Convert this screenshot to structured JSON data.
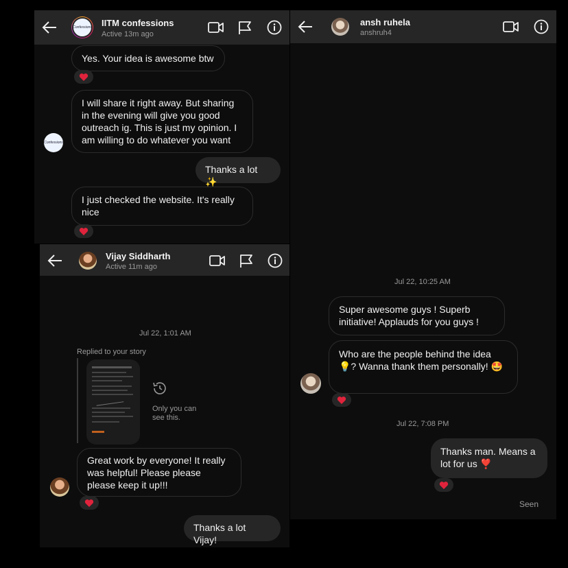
{
  "chat1": {
    "name": "IITM confessions",
    "status": "Active 13m ago",
    "avatar_text": "Confessions",
    "messages": [
      "Yes. Your idea is awesome btw",
      "I will share it right away. But sharing in the evening will give you good outreach ig. This is just my opinion. I am willing to do whatever you want",
      "Thanks a lot ✨",
      "I just checked the website. It's really nice"
    ]
  },
  "chat2": {
    "name": "Vijay Siddharth",
    "status": "Active 11m ago",
    "timestamp": "Jul 22, 1:01 AM",
    "story_reply_label": "Replied to your story",
    "story_note": "Only you can see this.",
    "messages": [
      "Great work by everyone! It really was helpful! Please please please keep it up!!!",
      "Thanks a lot Vijay!"
    ]
  },
  "chat3": {
    "name": "ansh ruhela",
    "username": "anshruh4",
    "timestamps": [
      "Jul 22, 10:25 AM",
      "Jul 22, 7:08 PM"
    ],
    "messages": [
      "Super awesome guys ! Superb initiative! Applauds for you guys !",
      "Who are the people behind the idea 💡? Wanna thank them personally! 🤩",
      "Thanks man. Means a lot for us ❣️"
    ],
    "seen": "Seen"
  },
  "colors": {
    "header_bg": "#262626",
    "panel_bg": "#0d0d0d",
    "heart": "#e0233c",
    "outgoing_bubble": "#262626"
  }
}
